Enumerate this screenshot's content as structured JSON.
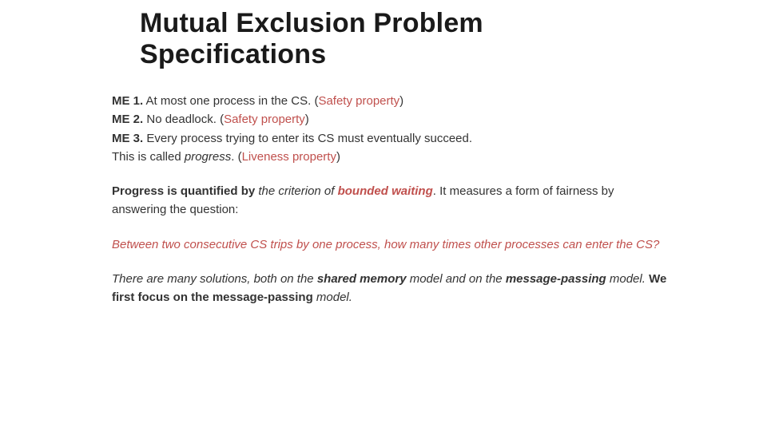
{
  "title_line1": "Mutual Exclusion Problem",
  "title_line2": "Specifications",
  "me1": {
    "label": "ME 1.",
    "text": " At most one process in the CS. (",
    "prop": "Safety property",
    "close": ")"
  },
  "me2": {
    "label": "ME 2.",
    "text": " No deadlock. (",
    "prop": "Safety property",
    "close": ")"
  },
  "me3": {
    "label": "ME 3.",
    "line1": " Every process trying to enter its CS must eventually succeed.",
    "line2a": "This is called ",
    "progress": "progress",
    "line2b": ". (",
    "prop": "Liveness property",
    "close": ")"
  },
  "para1": {
    "a": "Progress is quantified by",
    "b": " the criterion of ",
    "bw": "bounded waiting",
    "c": ". It measures a form of fairness by answering the question:"
  },
  "question": "Between two consecutive CS trips by one process, how many times other processes can enter the CS?",
  "para3": {
    "a": "There are many solutions, both on the ",
    "sm": "shared memory",
    "b": " model and on the ",
    "mp": "message-passing",
    "c": " model. ",
    "focus": "We first focus on the message-passing",
    "d": " model."
  }
}
